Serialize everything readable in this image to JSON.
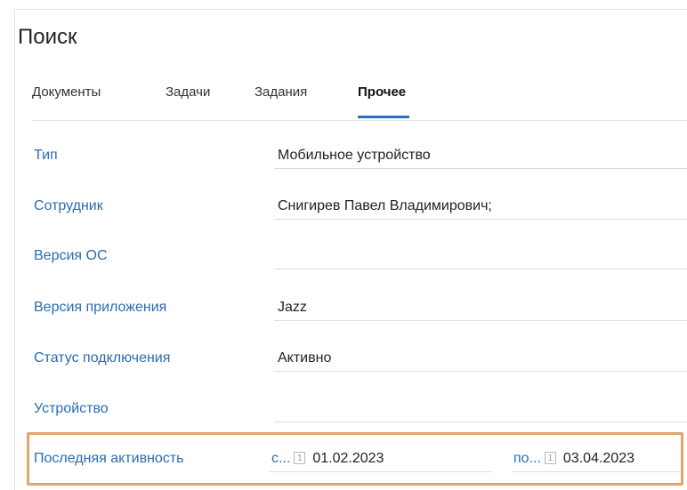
{
  "header": {
    "title": "Поиск"
  },
  "tabs": [
    {
      "label": "Документы",
      "active": false
    },
    {
      "label": "Задачи",
      "active": false
    },
    {
      "label": "Задания",
      "active": false
    },
    {
      "label": "Прочее",
      "active": true
    }
  ],
  "fields": [
    {
      "label": "Тип",
      "value": "Мобильное устройство"
    },
    {
      "label": "Сотрудник",
      "value": "Снигирев Павел Владимирович;"
    },
    {
      "label": "Версия ОС",
      "value": ""
    },
    {
      "label": "Версия приложения",
      "value": "Jazz"
    },
    {
      "label": "Статус подключения",
      "value": "Активно"
    },
    {
      "label": "Устройство",
      "value": ""
    }
  ],
  "last_activity": {
    "label": "Последняя активность",
    "from_prefix": "с...",
    "from_calendar_glyph": "1",
    "from_value": "01.02.2023",
    "to_prefix": "по...",
    "to_calendar_glyph": "1",
    "to_value": "03.04.2023"
  },
  "colors": {
    "accent": "#2a6fc9",
    "label_blue": "#2b6cb0",
    "highlight_border": "#e2a56b"
  }
}
